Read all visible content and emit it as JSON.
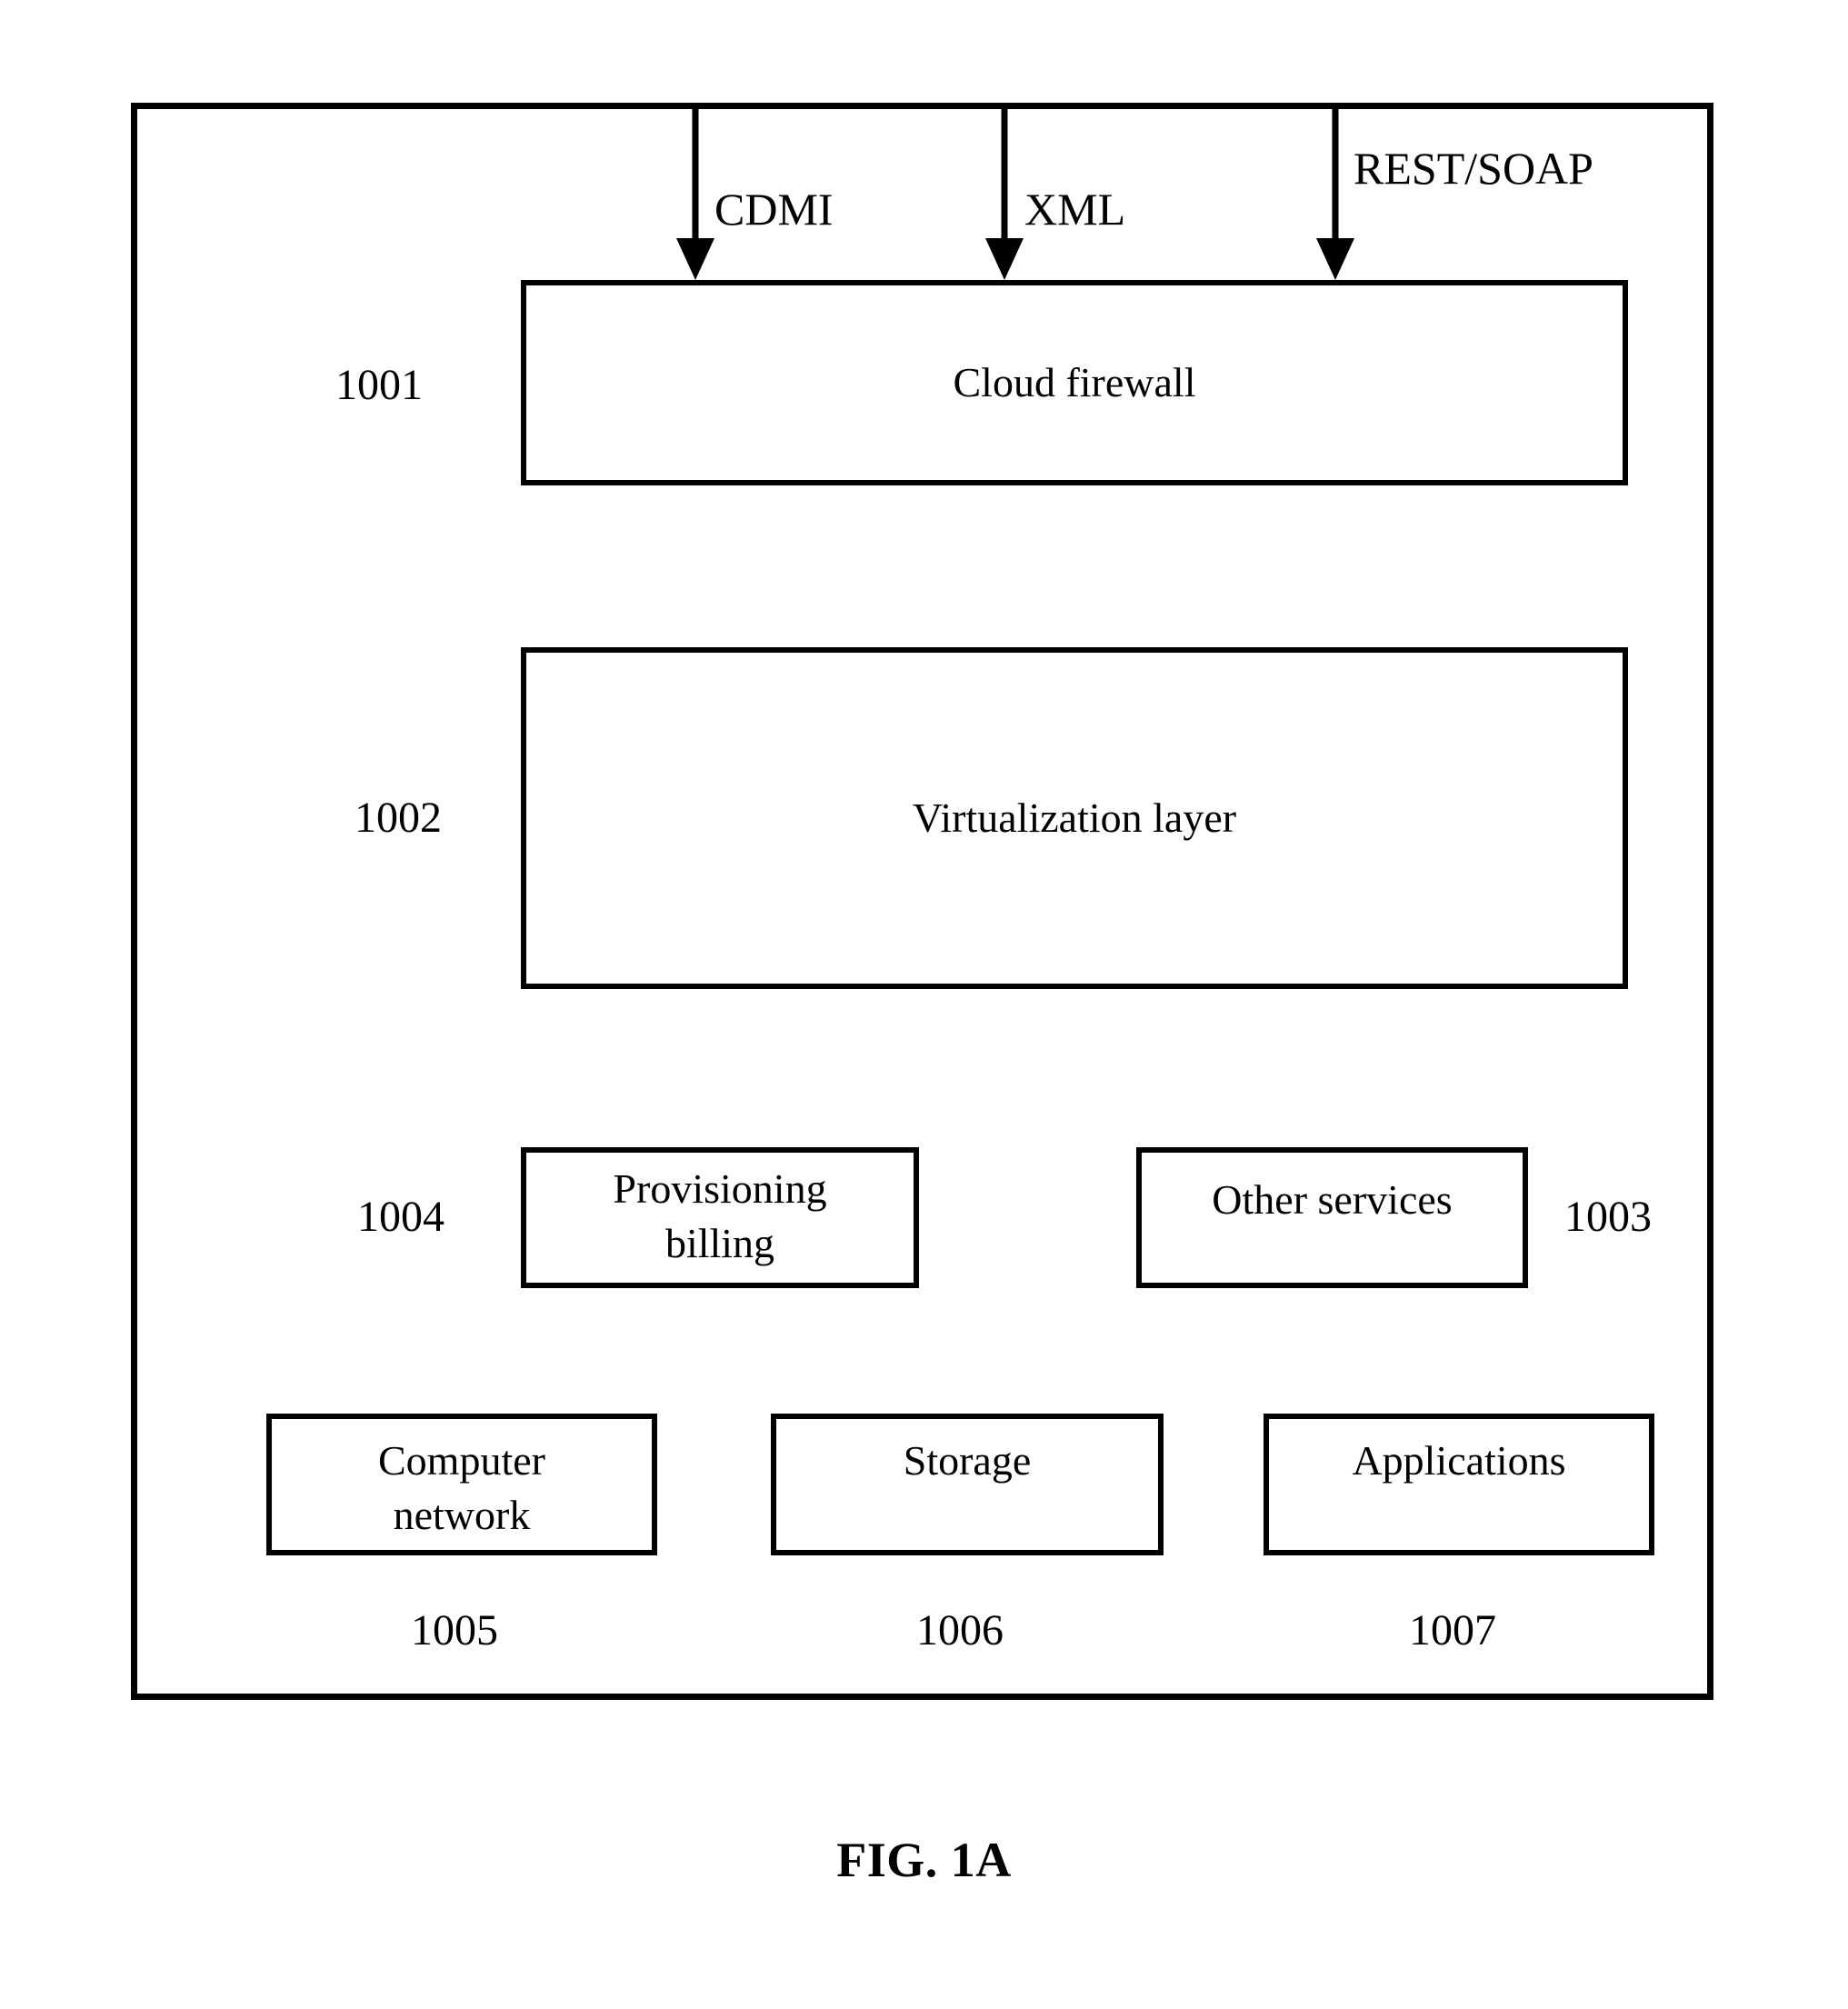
{
  "figure": {
    "caption": "FIG. 1A"
  },
  "protocols": [
    {
      "label": "CDMI",
      "name": "cdmi"
    },
    {
      "label": "XML",
      "name": "xml"
    },
    {
      "label": "REST/SOAP",
      "name": "rest-soap"
    }
  ],
  "boxes": {
    "cloud_firewall": {
      "label": "Cloud firewall",
      "ref": "1001"
    },
    "virtualization": {
      "label": "Virtualization layer",
      "ref": "1002"
    },
    "provisioning": {
      "label": "Provisioning\nbilling",
      "ref": "1004"
    },
    "other_services": {
      "label": "Other services",
      "ref": "1003"
    },
    "computer_network": {
      "label": "Computer\nnetwork",
      "ref": "1005"
    },
    "storage": {
      "label": "Storage",
      "ref": "1006"
    },
    "applications": {
      "label": "Applications",
      "ref": "1007"
    }
  },
  "colors": {
    "stroke": "#000000",
    "background": "#ffffff"
  }
}
